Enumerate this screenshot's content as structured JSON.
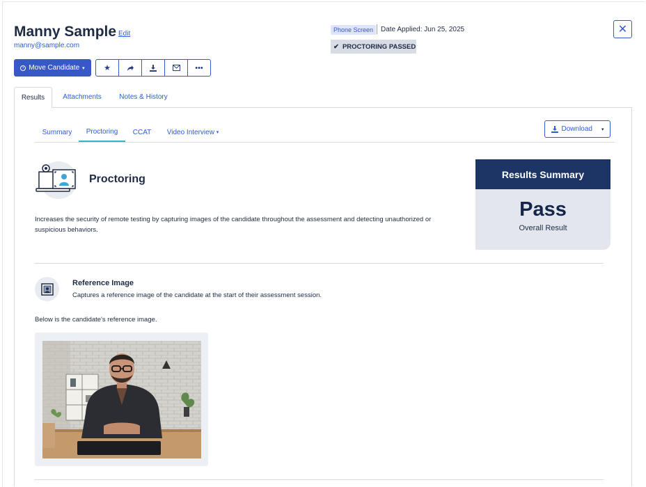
{
  "candidate": {
    "name": "Manny Sample",
    "edit_label": "Edit",
    "email": "manny@sample.com"
  },
  "actions": {
    "move_label": "Move Candidate",
    "icons": [
      "star-icon",
      "share-icon",
      "download-icon",
      "mail-icon",
      "more-icon"
    ]
  },
  "status": {
    "stage": "Phone Screen",
    "date_applied": "Date Applied: Jun 25, 2025",
    "proctoring": "PROCTORING PASSED"
  },
  "main_tabs": [
    {
      "label": "Results",
      "active": true
    },
    {
      "label": "Attachments",
      "active": false
    },
    {
      "label": "Notes & History",
      "active": false
    }
  ],
  "sub_tabs": [
    {
      "label": "Summary",
      "active": false
    },
    {
      "label": "Proctoring",
      "active": true
    },
    {
      "label": "CCAT",
      "active": false
    },
    {
      "label": "Video Interview",
      "active": false
    }
  ],
  "download_label": "Download",
  "proctoring": {
    "title": "Proctoring",
    "description": "Increases the security of remote testing by capturing images of the candidate throughout the assessment and detecting unauthorized or suspicious behaviors."
  },
  "results_summary": {
    "heading": "Results Summary",
    "value": "Pass",
    "caption": "Overall Result"
  },
  "reference": {
    "title": "Reference Image",
    "description": "Captures a reference image of the candidate at the start of their assessment session.",
    "intro": "Below is the candidate's reference image."
  },
  "colors": {
    "accent": "#3858c8",
    "link": "#2b5bd8",
    "navy": "#1c3565",
    "active_tab_underline": "#34b6c6"
  }
}
